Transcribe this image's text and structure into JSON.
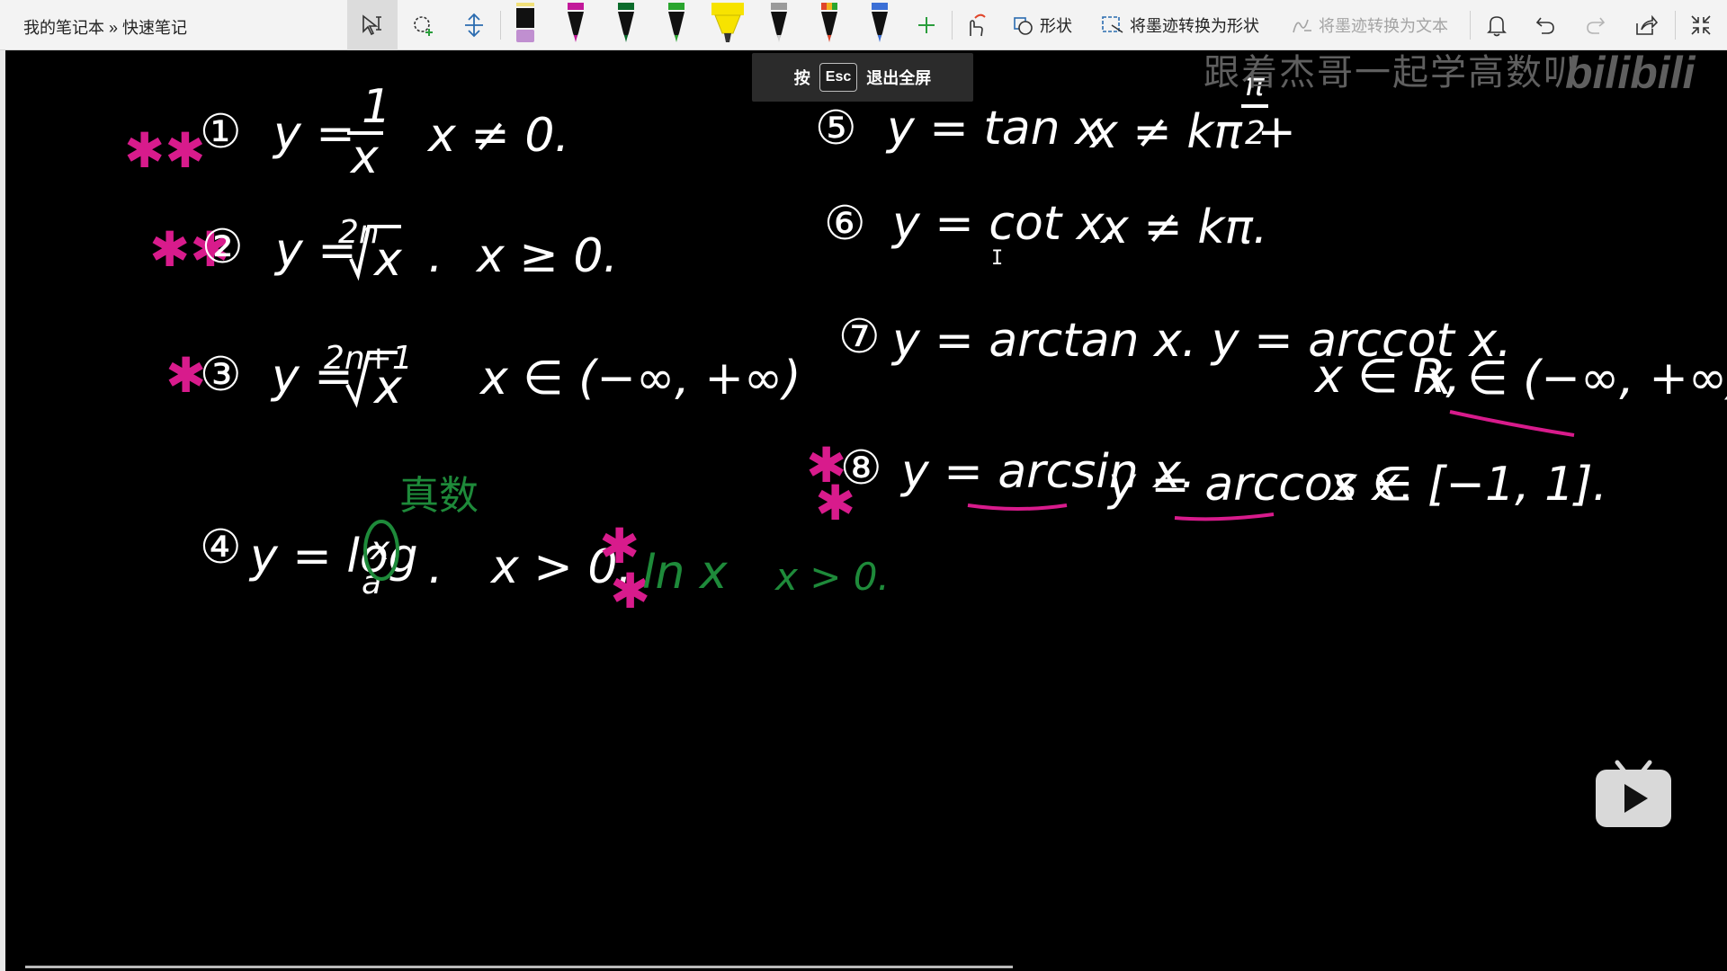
{
  "window": {
    "title": "我的笔记本 » 快速笔记"
  },
  "toolbar": {
    "shape_label": "形状",
    "ink_to_shape_label": "将墨迹转换为形状",
    "ink_to_text_label": "将墨迹转换为文本",
    "pens": [
      {
        "icon": "pen-black-pink-icon",
        "color": "#111111",
        "cap": "#c08fd0"
      },
      {
        "icon": "pen-magenta-icon",
        "color": "#c2189a"
      },
      {
        "icon": "pen-darkgreen-icon",
        "color": "#0a6b2b"
      },
      {
        "icon": "pen-green-icon",
        "color": "#2aa52e"
      },
      {
        "icon": "highlighter-yellow-icon",
        "color": "#f7e300"
      },
      {
        "icon": "pen-silver-icon",
        "color": "#9a9a9a"
      },
      {
        "icon": "pen-rainbow-icon",
        "color": "#e0452a"
      },
      {
        "icon": "pen-galaxy-icon",
        "color": "#3b6fd6"
      }
    ]
  },
  "esc_popup": {
    "prefix": "按",
    "key": "Esc",
    "suffix": "退出全屏"
  },
  "watermark": {
    "text": "跟着杰哥一起学高数叭",
    "brand": "bilibili"
  },
  "notes": {
    "item1": {
      "num": "①",
      "formula": "y = 1/x",
      "numerator": "1",
      "denominator": "x",
      "prefix": "y =",
      "domain": "x ≠ 0."
    },
    "item2": {
      "num": "②",
      "formula": "y = ²ⁿ√x",
      "index": "2n",
      "radicand": "x",
      "prefix": "y =",
      "domain": "x ≥ 0."
    },
    "item3": {
      "num": "③",
      "index": "2n+1",
      "radicand": "x",
      "prefix": "y =",
      "domain": "x ∈ (−∞, +∞)"
    },
    "item4": {
      "num": "④",
      "prefix": "y = log",
      "base": "a",
      "arg": "x",
      "domain": "x > 0.",
      "note_green": "真数",
      "ln": "ln x",
      "ln_domain": "x > 0."
    },
    "item5": {
      "num": "⑤",
      "formula": "y = tan x",
      "domain": "x ≠ kπ +",
      "frac_num": "π",
      "frac_den": "2"
    },
    "item6": {
      "num": "⑥",
      "formula": "y = cot x.",
      "domain": "x ≠ kπ."
    },
    "item7": {
      "num": "⑦",
      "formula": "y = arctan x.  y = arccot x.",
      "domain1": "x ∈ R,",
      "domain2": "x ∈ (−∞, +∞)"
    },
    "item8": {
      "num": "⑧",
      "formula1": "y = arcsin x.",
      "formula2": "y = arccos x.",
      "domain": "x ∈ [−1, 1]."
    }
  },
  "colors": {
    "ink": "#ffffff",
    "accent_pink": "#d81b8c",
    "accent_green": "#1e8a3a",
    "canvas": "#000000"
  }
}
